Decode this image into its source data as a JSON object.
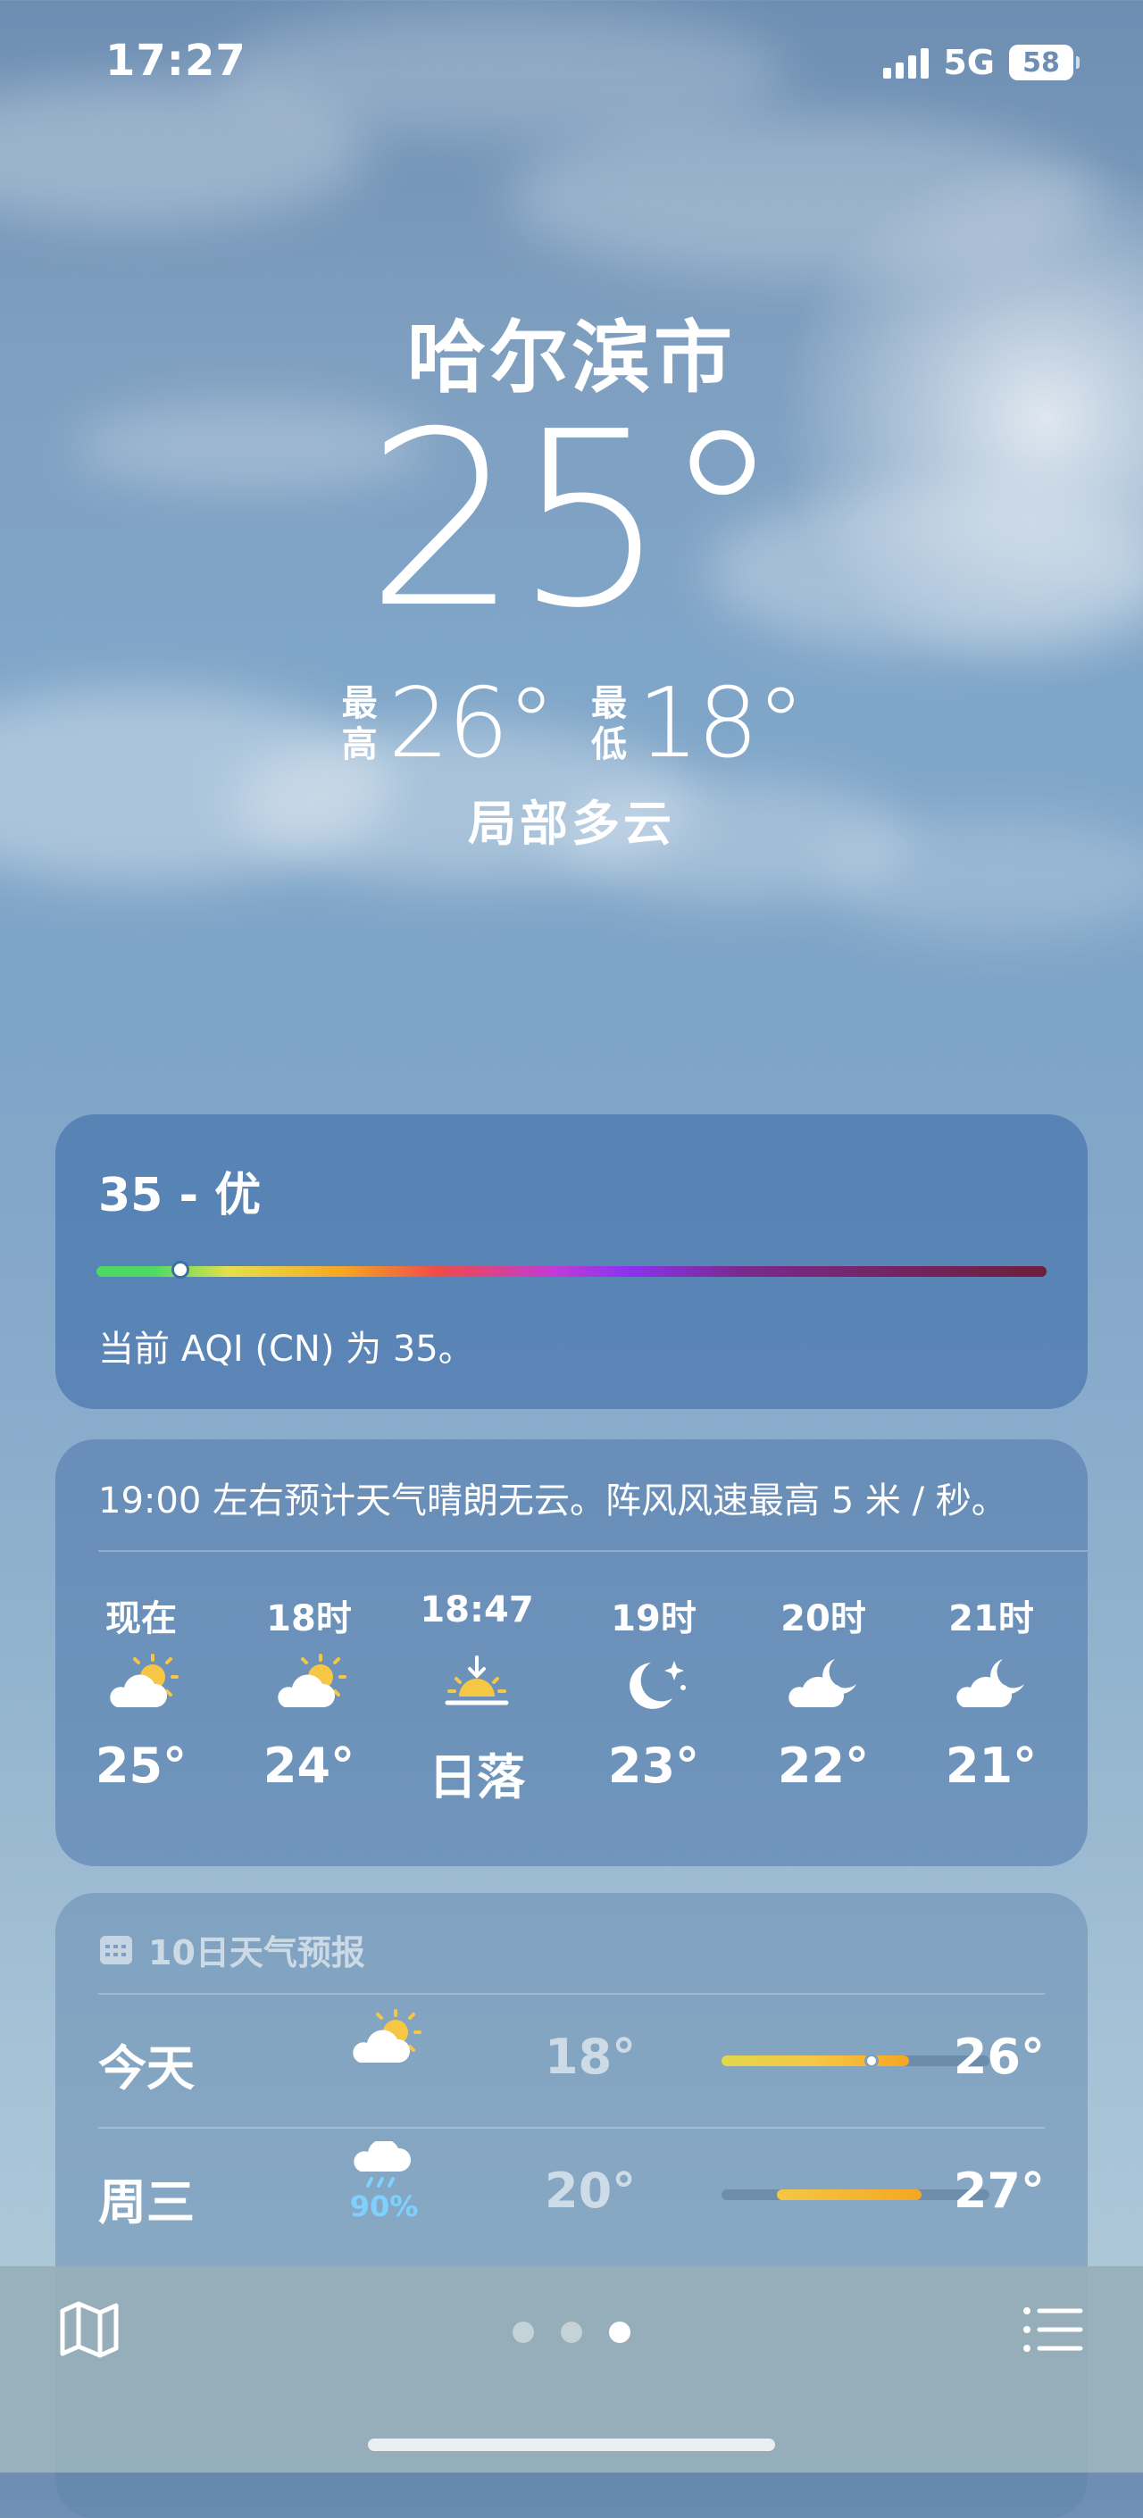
{
  "status_bar": {
    "time": "17:27",
    "network": "5G",
    "battery": "58"
  },
  "location": {
    "city": "哈尔滨市",
    "temperature": "25°",
    "high_label": "最高",
    "high": "26°",
    "low_label": "最低",
    "low": "18°",
    "condition": "局部多云"
  },
  "aqi": {
    "title": "35 - 优",
    "value": 35,
    "description": "当前 AQI (CN) 为 35。"
  },
  "hourly": {
    "summary": "19:00 左右预计天气晴朗无云。阵风风速最高 5 米 / 秒。",
    "items": [
      {
        "time": "现在",
        "icon": "partly-sunny-icon",
        "temp": "25°"
      },
      {
        "time": "18时",
        "icon": "partly-sunny-icon",
        "temp": "24°"
      },
      {
        "time": "18:47",
        "icon": "sunset-icon",
        "temp": "日落"
      },
      {
        "time": "19时",
        "icon": "moon-stars-icon",
        "temp": "23°"
      },
      {
        "time": "20时",
        "icon": "cloud-moon-icon",
        "temp": "22°"
      },
      {
        "time": "21时",
        "icon": "cloud-moon-icon",
        "temp": "21°"
      }
    ]
  },
  "forecast": {
    "header": "10日天气预报",
    "days": [
      {
        "day": "今天",
        "icon": "partly-sunny-icon",
        "precip": "",
        "low": "18°",
        "high": "26°"
      },
      {
        "day": "周三",
        "icon": "rain-cloud-icon",
        "precip": "90%",
        "low": "20°",
        "high": "27°"
      }
    ]
  },
  "bottom_bar": {
    "pages": 3,
    "active_page": 3
  },
  "colors": {
    "accent_yellow": "#f5c744",
    "orange": "#f5a623",
    "rain_blue": "#7fd0ff"
  }
}
